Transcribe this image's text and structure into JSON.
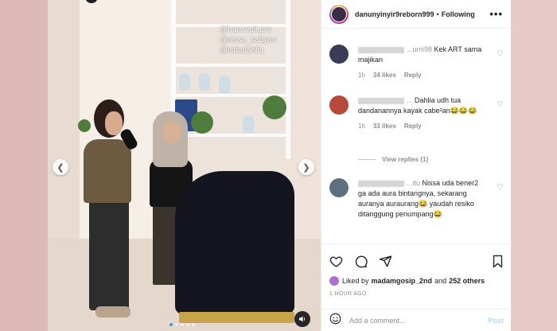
{
  "media": {
    "watermarks": [
      "@harewell.pro",
      "@nissa_sabyan",
      "@isdadahlia"
    ],
    "prev_icon": "chevron-left-icon",
    "next_icon": "chevron-right-icon",
    "sound_icon": "speaker-icon"
  },
  "header": {
    "username": "danunyinyir9reborn999",
    "separator": "•",
    "follow_status": "Following",
    "more": "•••"
  },
  "comments": [
    {
      "user": "...umi98",
      "text": "Kek ART sama majikan",
      "time": "1h",
      "likes": "34 likes",
      "reply": "Reply",
      "avatar_color": "#3b3b55"
    },
    {
      "user": "...",
      "text": "Dahlia udh tua dandanannya kayak cabe²an😂😂😂",
      "time": "1h",
      "likes": "33 likes",
      "reply": "Reply",
      "avatar_color": "#b74a3a",
      "view_replies": "View replies (1)"
    },
    {
      "user": "...itu",
      "text": "Nissa uda bener2 ga ada aura bintangnya, sekarang auranya auraurang😂 yaudah resiko ditanggung penumpang😂",
      "time": "",
      "likes": "",
      "reply": "",
      "avatar_color": "#5e6f82"
    }
  ],
  "actions": {
    "like_icon": "heart-icon",
    "comment_icon": "comment-icon",
    "share_icon": "share-icon",
    "save_icon": "bookmark-icon"
  },
  "likes": {
    "prefix": "Liked by",
    "user": "madamgosip_2nd",
    "conj": "and",
    "others": "252 others"
  },
  "timestamp": "1 HOUR AGO",
  "add_comment": {
    "placeholder": "Add a comment...",
    "post_label": "Post",
    "emoji_icon": "smiley-icon"
  }
}
